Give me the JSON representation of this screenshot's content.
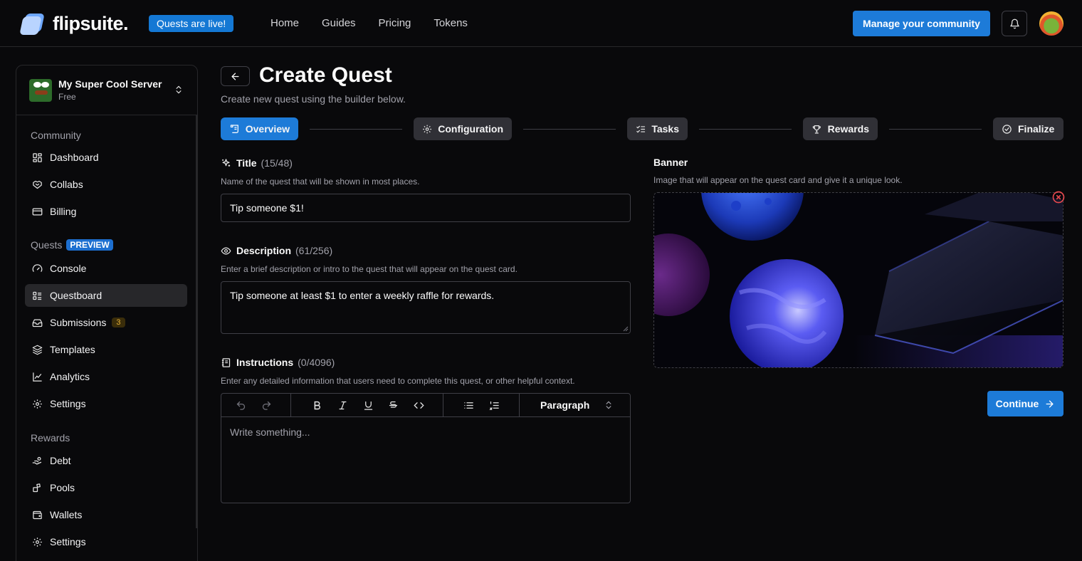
{
  "brand": {
    "name": "flipsuite.",
    "badge": "Quests are live!"
  },
  "nav": {
    "items": [
      "Home",
      "Guides",
      "Pricing",
      "Tokens"
    ]
  },
  "header": {
    "manage_label": "Manage your community"
  },
  "sidebar": {
    "server": {
      "name": "My Super Cool Server",
      "plan": "Free"
    },
    "sections": {
      "community": "Community",
      "quests": "Quests",
      "quests_badge": "PREVIEW",
      "rewards": "Rewards"
    },
    "community_items": [
      "Dashboard",
      "Collabs",
      "Billing"
    ],
    "quest_items": [
      "Console",
      "Questboard",
      "Submissions",
      "Templates",
      "Analytics",
      "Settings"
    ],
    "submissions_count": "3",
    "reward_items": [
      "Debt",
      "Pools",
      "Wallets",
      "Settings"
    ],
    "active_item": "Questboard"
  },
  "page": {
    "title": "Create Quest",
    "subtitle": "Create new quest using the builder below."
  },
  "steps": [
    "Overview",
    "Configuration",
    "Tasks",
    "Rewards",
    "Finalize"
  ],
  "active_step": "Overview",
  "form": {
    "title": {
      "label": "Title",
      "count": "(15/48)",
      "help": "Name of the quest that will be shown in most places.",
      "value": "Tip someone $1!"
    },
    "description": {
      "label": "Description",
      "count": "(61/256)",
      "help": "Enter a brief description or intro to the quest that will appear on the quest card.",
      "value": "Tip someone at least $1 to enter a weekly raffle for rewards."
    },
    "instructions": {
      "label": "Instructions",
      "count": "(0/4096)",
      "help": "Enter any detailed information that users need to complete this quest, or other helpful context.",
      "placeholder": "Write something...",
      "block_type": "Paragraph"
    },
    "banner": {
      "label": "Banner",
      "help": "Image that will appear on the quest card and give it a unique look."
    }
  },
  "actions": {
    "continue_label": "Continue"
  },
  "colors": {
    "accent": "#1d7bd8",
    "background": "#09090b",
    "border": "#27272a"
  }
}
